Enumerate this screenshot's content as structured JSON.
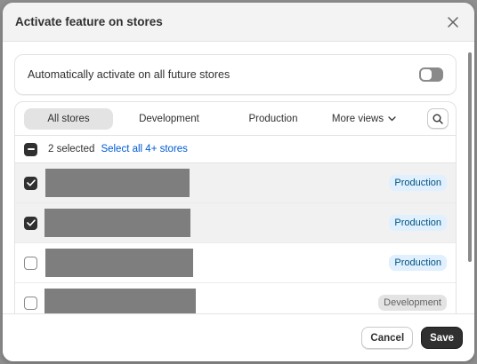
{
  "modal": {
    "title": "Activate feature on stores"
  },
  "auto_activate": {
    "label": "Automatically activate on all future stores",
    "enabled": false
  },
  "tabs": [
    {
      "label": "All stores",
      "active": true
    },
    {
      "label": "Development",
      "active": false
    },
    {
      "label": "Production",
      "active": false
    },
    {
      "label": "More views",
      "active": false
    }
  ],
  "selection": {
    "count_text": "2 selected",
    "select_all_text": "Select all 4+ stores"
  },
  "stores": [
    {
      "checked": true,
      "badge": "Production",
      "badge_type": "prod"
    },
    {
      "checked": true,
      "badge": "Production",
      "badge_type": "prod"
    },
    {
      "checked": false,
      "badge": "Production",
      "badge_type": "prod"
    },
    {
      "checked": false,
      "badge": "Development",
      "badge_type": "dev"
    }
  ],
  "footer": {
    "cancel_label": "Cancel",
    "save_label": "Save"
  },
  "colors": {
    "accent_link": "#005bd3",
    "primary_button": "#303030",
    "production_badge_bg": "#e0f0ff",
    "development_badge_bg": "#e3e3e3"
  }
}
